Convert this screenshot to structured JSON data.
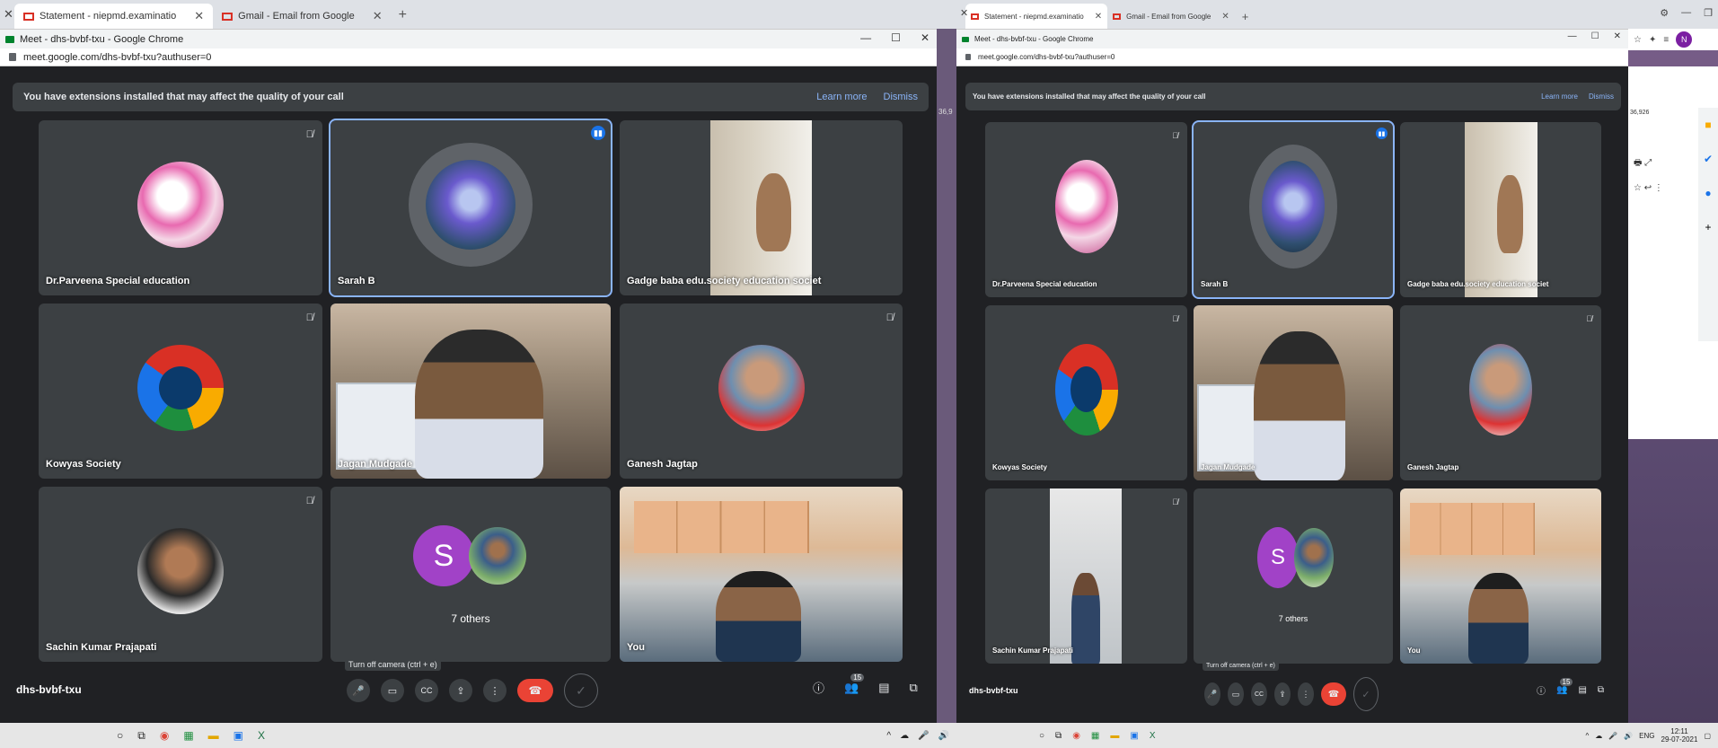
{
  "screens": [
    {
      "tabs": [
        {
          "label": "Statement - niepmd.examinatio",
          "active": true
        },
        {
          "label": "Gmail - Email from Google",
          "active": false
        }
      ],
      "window_title": "Meet - dhs-bvbf-txu - Google Chrome",
      "url": "meet.google.com/dhs-bvbf-txu?authuser=0",
      "banner": {
        "text": "You have extensions installed that may affect the quality of your call",
        "learn_more": "Learn more",
        "dismiss": "Dismiss"
      },
      "tiles": [
        {
          "name": "Dr.Parveena Special education"
        },
        {
          "name": "Sarah B"
        },
        {
          "name": "Gadge baba edu.society education societ"
        },
        {
          "name": "Kowyas Society"
        },
        {
          "name": "Jagan Mudgade"
        },
        {
          "name": "Ganesh Jagtap"
        },
        {
          "name": "Sachin Kumar Prajapati"
        },
        {
          "name": "7 others",
          "avatar_letter": "S"
        },
        {
          "name": "You"
        }
      ],
      "meeting_code": "dhs-bvbf-txu",
      "tooltip": "Turn off camera (ctrl + e)",
      "participant_count": "15"
    },
    {
      "tabs": [
        {
          "label": "Statement - niepmd.examinatio",
          "active": true
        },
        {
          "label": "Gmail - Email from Google",
          "active": false
        }
      ],
      "window_title": "Meet - dhs-bvbf-txu - Google Chrome",
      "url": "meet.google.com/dhs-bvbf-txu?authuser=0",
      "banner": {
        "text": "You have extensions installed that may affect the quality of your call",
        "learn_more": "Learn more",
        "dismiss": "Dismiss"
      },
      "tiles": [
        {
          "name": "Dr.Parveena Special education"
        },
        {
          "name": "Sarah B"
        },
        {
          "name": "Gadge baba edu.society education societ"
        },
        {
          "name": "Kowyas Society"
        },
        {
          "name": "Jagan Mudgade"
        },
        {
          "name": "Ganesh Jagtap"
        },
        {
          "name": "Sachin Kumar Prajapati"
        },
        {
          "name": "7 others",
          "avatar_letter": "S"
        },
        {
          "name": "You"
        }
      ],
      "meeting_code": "dhs-bvbf-txu",
      "tooltip": "Turn off camera (ctrl + e)",
      "participant_count": "15",
      "clock_time": "12:11",
      "clock_date": "29-07-2021",
      "tray_lang": "ENG",
      "bg_numbers": [
        "36,9",
        "36,926"
      ]
    }
  ],
  "icons": [
    "gmail-icon",
    "meet-icon",
    "lock-icon",
    "mic-off-icon",
    "speaking-icon",
    "mic-icon",
    "camera-icon",
    "captions-icon",
    "present-icon",
    "more-icon",
    "end-call-icon",
    "info-icon",
    "people-icon",
    "chat-icon",
    "activities-icon"
  ],
  "colors": {
    "meet_bg": "#202124",
    "tile_bg": "#3c4043",
    "end_call": "#ea4335",
    "link": "#8ab4f8",
    "speaking_border": "#8ab4f8"
  }
}
